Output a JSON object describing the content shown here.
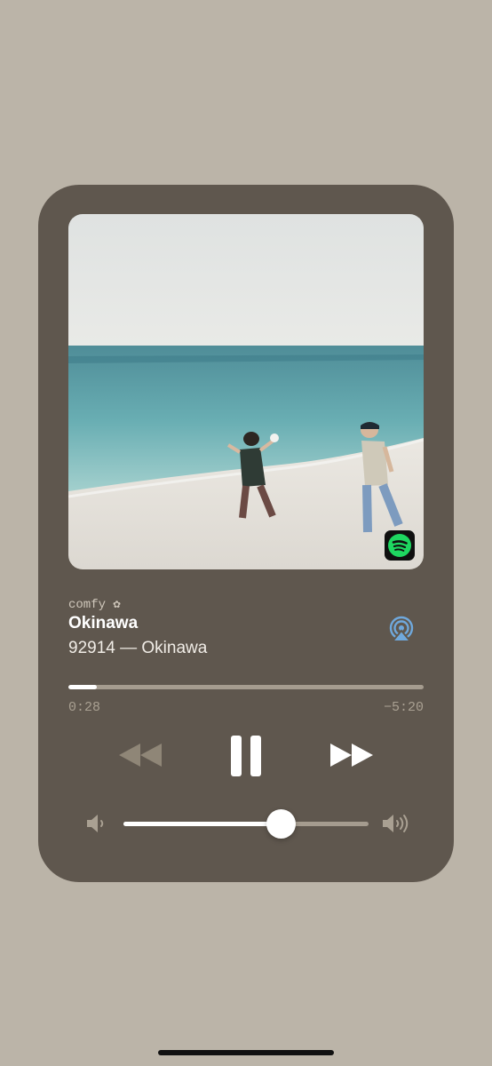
{
  "player": {
    "source_label": "comfy ✿",
    "track_title": "Okinawa",
    "track_subtitle": "92914 — Okinawa",
    "elapsed": "0:28",
    "remaining": "−5:20",
    "progress_fraction": 0.08,
    "volume_fraction": 0.64
  },
  "icons": {
    "artwork": "beach-photo",
    "badge": "spotify-icon",
    "output": "airplay-icon",
    "rewind": "rewind-icon",
    "pause": "pause-icon",
    "forward": "fast-forward-icon",
    "volume_low": "speaker-low-icon",
    "volume_high": "speaker-high-icon"
  },
  "colors": {
    "background": "#bbb4a8",
    "card": "#5f574e",
    "spotify_green": "#1ed760",
    "airplay_blue": "#6fa8dc"
  }
}
